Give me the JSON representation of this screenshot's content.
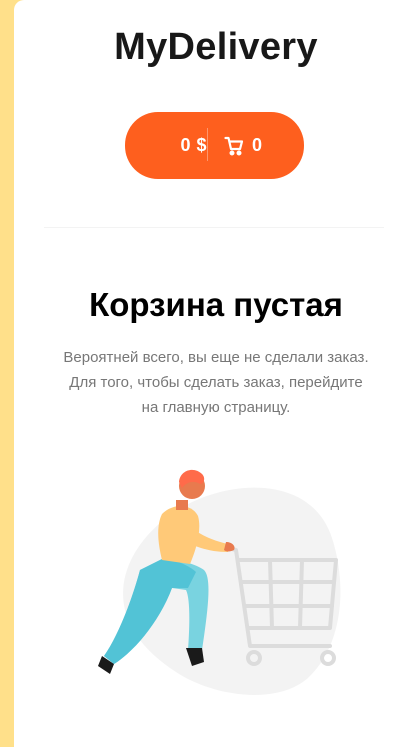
{
  "header": {
    "logo": "MyDelivery",
    "cart_total": "0 $",
    "cart_count": "0",
    "cart_icon": "cart-icon"
  },
  "empty_cart": {
    "title": "Корзина пустая",
    "line1": "Вероятней всего, вы еще не сделали заказ.",
    "line2": "Для того, чтобы сделать заказ, перейдите",
    "line3": "на главную страницу.",
    "illustration": "shopping-cart-person-illustration"
  },
  "colors": {
    "accent": "#fe5f1e",
    "background": "#ffe08a",
    "card": "#ffffff"
  }
}
